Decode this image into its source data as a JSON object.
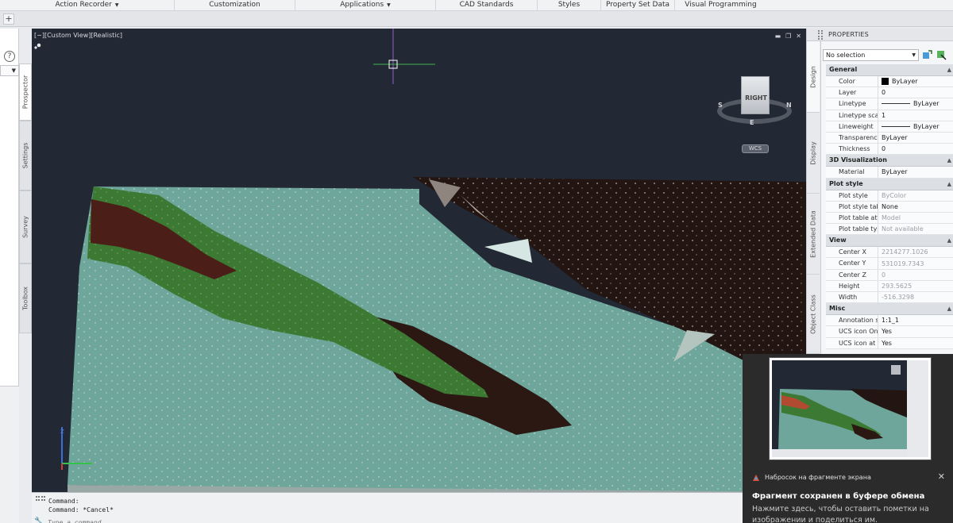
{
  "ribbon": {
    "tabs": [
      {
        "label": "Action Recorder",
        "dropdown": true
      },
      {
        "label": "Customization",
        "dropdown": false
      },
      {
        "label": "Applications",
        "dropdown": true
      },
      {
        "label": "CAD Standards",
        "dropdown": false
      },
      {
        "label": "Styles",
        "dropdown": false
      },
      {
        "label": "Property Set Data",
        "dropdown": false
      },
      {
        "label": "Visual Programming",
        "dropdown": false
      }
    ],
    "new_tab_symbol": "+"
  },
  "left_palette": {
    "help_symbol": "?",
    "tabs": [
      "Prospector",
      "Settings",
      "Survey",
      "Toolbox"
    ]
  },
  "viewport": {
    "label": "[−][Custom View][Realistic]",
    "controls": [
      "minimize-icon",
      "restore-icon",
      "close-icon"
    ],
    "viewcube": {
      "face": "RIGHT",
      "dirs": {
        "s": "S",
        "n": "N",
        "e": "E"
      },
      "wcs": "WCS"
    },
    "axis": {
      "z": "Z"
    }
  },
  "command": {
    "history": [
      "Command:",
      "Command: *Cancel*"
    ],
    "placeholder": "Type a command"
  },
  "properties": {
    "title": "PROPERTIES",
    "selection": "No selection",
    "side_tabs": [
      "Design",
      "Display",
      "Extended Data",
      "Object Class"
    ],
    "categories": [
      {
        "name": "General",
        "rows": [
          {
            "key": "Color",
            "value": "ByLayer",
            "swatch": "#000000"
          },
          {
            "key": "Layer",
            "value": "0"
          },
          {
            "key": "Linetype",
            "value": "ByLayer",
            "line": true
          },
          {
            "key": "Linetype scale",
            "value": "1"
          },
          {
            "key": "Lineweight",
            "value": "ByLayer",
            "line": true
          },
          {
            "key": "Transparency",
            "value": "ByLayer"
          },
          {
            "key": "Thickness",
            "value": "0"
          }
        ]
      },
      {
        "name": "3D Visualization",
        "rows": [
          {
            "key": "Material",
            "value": "ByLayer"
          }
        ]
      },
      {
        "name": "Plot style",
        "rows": [
          {
            "key": "Plot style",
            "value": "ByColor",
            "dim": true
          },
          {
            "key": "Plot style table",
            "value": "None"
          },
          {
            "key": "Plot table att...",
            "value": "Model",
            "dim": true
          },
          {
            "key": "Plot table type",
            "value": "Not available",
            "dim": true
          }
        ]
      },
      {
        "name": "View",
        "rows": [
          {
            "key": "Center X",
            "value": "2214277.1026",
            "dim": true
          },
          {
            "key": "Center Y",
            "value": "531019.7343",
            "dim": true
          },
          {
            "key": "Center Z",
            "value": "0",
            "dim": true
          },
          {
            "key": "Height",
            "value": "293.5625",
            "dim": true
          },
          {
            "key": "Width",
            "value": "-516.3298",
            "dim": true
          }
        ]
      },
      {
        "name": "Misc",
        "rows": [
          {
            "key": "Annotation s...",
            "value": "1:1_1"
          },
          {
            "key": "UCS icon On",
            "value": "Yes"
          },
          {
            "key": "UCS icon at o...",
            "value": "Yes"
          }
        ]
      }
    ]
  },
  "toast": {
    "app_name": "Набросок на фрагменте экрана",
    "title": "Фрагмент сохранен в буфере обмена",
    "body": "Нажмите здесь, чтобы оставить пометки на изображении и поделиться им.",
    "close_symbol": "✕"
  },
  "colors": {
    "viewport_bg": "#222834",
    "surface_water": "#6ea69b",
    "vegetation": "#3c7a34",
    "soil": "#4b1f17",
    "dark_terrain": "#231511",
    "toast_bg": "#2b2b2b"
  }
}
